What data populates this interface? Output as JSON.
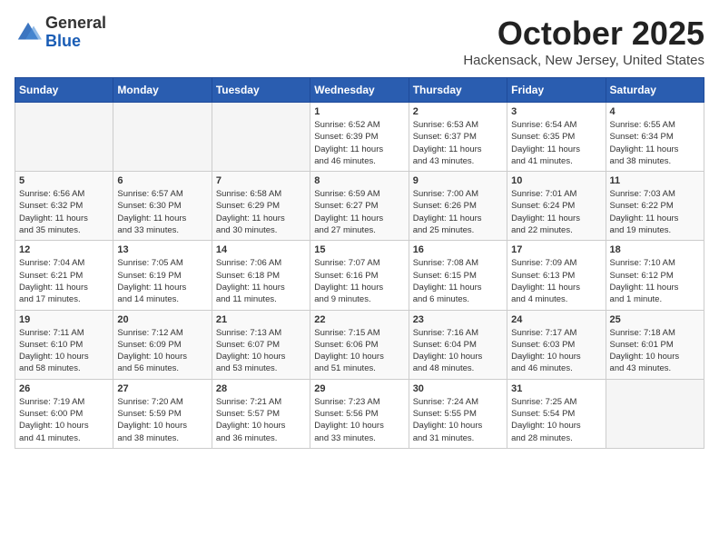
{
  "logo": {
    "general": "General",
    "blue": "Blue"
  },
  "header": {
    "month": "October 2025",
    "location": "Hackensack, New Jersey, United States"
  },
  "weekdays": [
    "Sunday",
    "Monday",
    "Tuesday",
    "Wednesday",
    "Thursday",
    "Friday",
    "Saturday"
  ],
  "weeks": [
    [
      {
        "day": "",
        "info": ""
      },
      {
        "day": "",
        "info": ""
      },
      {
        "day": "",
        "info": ""
      },
      {
        "day": "1",
        "info": "Sunrise: 6:52 AM\nSunset: 6:39 PM\nDaylight: 11 hours\nand 46 minutes."
      },
      {
        "day": "2",
        "info": "Sunrise: 6:53 AM\nSunset: 6:37 PM\nDaylight: 11 hours\nand 43 minutes."
      },
      {
        "day": "3",
        "info": "Sunrise: 6:54 AM\nSunset: 6:35 PM\nDaylight: 11 hours\nand 41 minutes."
      },
      {
        "day": "4",
        "info": "Sunrise: 6:55 AM\nSunset: 6:34 PM\nDaylight: 11 hours\nand 38 minutes."
      }
    ],
    [
      {
        "day": "5",
        "info": "Sunrise: 6:56 AM\nSunset: 6:32 PM\nDaylight: 11 hours\nand 35 minutes."
      },
      {
        "day": "6",
        "info": "Sunrise: 6:57 AM\nSunset: 6:30 PM\nDaylight: 11 hours\nand 33 minutes."
      },
      {
        "day": "7",
        "info": "Sunrise: 6:58 AM\nSunset: 6:29 PM\nDaylight: 11 hours\nand 30 minutes."
      },
      {
        "day": "8",
        "info": "Sunrise: 6:59 AM\nSunset: 6:27 PM\nDaylight: 11 hours\nand 27 minutes."
      },
      {
        "day": "9",
        "info": "Sunrise: 7:00 AM\nSunset: 6:26 PM\nDaylight: 11 hours\nand 25 minutes."
      },
      {
        "day": "10",
        "info": "Sunrise: 7:01 AM\nSunset: 6:24 PM\nDaylight: 11 hours\nand 22 minutes."
      },
      {
        "day": "11",
        "info": "Sunrise: 7:03 AM\nSunset: 6:22 PM\nDaylight: 11 hours\nand 19 minutes."
      }
    ],
    [
      {
        "day": "12",
        "info": "Sunrise: 7:04 AM\nSunset: 6:21 PM\nDaylight: 11 hours\nand 17 minutes."
      },
      {
        "day": "13",
        "info": "Sunrise: 7:05 AM\nSunset: 6:19 PM\nDaylight: 11 hours\nand 14 minutes."
      },
      {
        "day": "14",
        "info": "Sunrise: 7:06 AM\nSunset: 6:18 PM\nDaylight: 11 hours\nand 11 minutes."
      },
      {
        "day": "15",
        "info": "Sunrise: 7:07 AM\nSunset: 6:16 PM\nDaylight: 11 hours\nand 9 minutes."
      },
      {
        "day": "16",
        "info": "Sunrise: 7:08 AM\nSunset: 6:15 PM\nDaylight: 11 hours\nand 6 minutes."
      },
      {
        "day": "17",
        "info": "Sunrise: 7:09 AM\nSunset: 6:13 PM\nDaylight: 11 hours\nand 4 minutes."
      },
      {
        "day": "18",
        "info": "Sunrise: 7:10 AM\nSunset: 6:12 PM\nDaylight: 11 hours\nand 1 minute."
      }
    ],
    [
      {
        "day": "19",
        "info": "Sunrise: 7:11 AM\nSunset: 6:10 PM\nDaylight: 10 hours\nand 58 minutes."
      },
      {
        "day": "20",
        "info": "Sunrise: 7:12 AM\nSunset: 6:09 PM\nDaylight: 10 hours\nand 56 minutes."
      },
      {
        "day": "21",
        "info": "Sunrise: 7:13 AM\nSunset: 6:07 PM\nDaylight: 10 hours\nand 53 minutes."
      },
      {
        "day": "22",
        "info": "Sunrise: 7:15 AM\nSunset: 6:06 PM\nDaylight: 10 hours\nand 51 minutes."
      },
      {
        "day": "23",
        "info": "Sunrise: 7:16 AM\nSunset: 6:04 PM\nDaylight: 10 hours\nand 48 minutes."
      },
      {
        "day": "24",
        "info": "Sunrise: 7:17 AM\nSunset: 6:03 PM\nDaylight: 10 hours\nand 46 minutes."
      },
      {
        "day": "25",
        "info": "Sunrise: 7:18 AM\nSunset: 6:01 PM\nDaylight: 10 hours\nand 43 minutes."
      }
    ],
    [
      {
        "day": "26",
        "info": "Sunrise: 7:19 AM\nSunset: 6:00 PM\nDaylight: 10 hours\nand 41 minutes."
      },
      {
        "day": "27",
        "info": "Sunrise: 7:20 AM\nSunset: 5:59 PM\nDaylight: 10 hours\nand 38 minutes."
      },
      {
        "day": "28",
        "info": "Sunrise: 7:21 AM\nSunset: 5:57 PM\nDaylight: 10 hours\nand 36 minutes."
      },
      {
        "day": "29",
        "info": "Sunrise: 7:23 AM\nSunset: 5:56 PM\nDaylight: 10 hours\nand 33 minutes."
      },
      {
        "day": "30",
        "info": "Sunrise: 7:24 AM\nSunset: 5:55 PM\nDaylight: 10 hours\nand 31 minutes."
      },
      {
        "day": "31",
        "info": "Sunrise: 7:25 AM\nSunset: 5:54 PM\nDaylight: 10 hours\nand 28 minutes."
      },
      {
        "day": "",
        "info": ""
      }
    ]
  ]
}
